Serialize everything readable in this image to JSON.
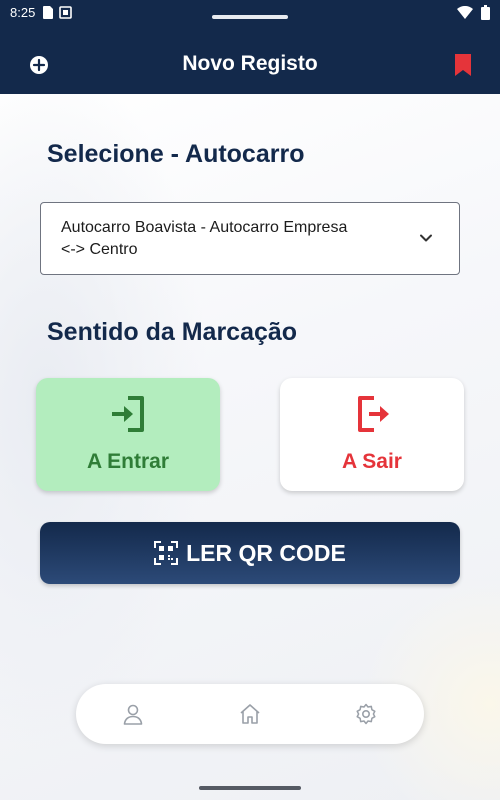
{
  "status_bar": {
    "time": "8:25",
    "left_icons": [
      "sim-card-icon",
      "square-icon"
    ],
    "right_icons": [
      "wifi-icon",
      "battery-icon"
    ]
  },
  "app_bar": {
    "title": "Novo Registo",
    "left_icon": "add-circle-icon",
    "right_icon": "bookmark-icon",
    "bookmark_color": "#e5343a"
  },
  "bus_section": {
    "heading": "Selecione - Autocarro",
    "selected_bus_line1": "Autocarro Boavista - Autocarro Empresa",
    "selected_bus_line2": "<-> Centro"
  },
  "direction_section": {
    "heading": "Sentido da Marcação",
    "enter_label": "A Entrar",
    "exit_label": "A Sair",
    "enter_color": "#2f7d37",
    "exit_color": "#e5343a",
    "selected": "A Entrar"
  },
  "qr_button": {
    "label": "LER QR CODE",
    "icon": "qr-code-scan-icon"
  },
  "bottom_nav": {
    "items": [
      {
        "icon": "profile-icon"
      },
      {
        "icon": "home-icon"
      },
      {
        "icon": "settings-icon"
      }
    ]
  },
  "colors": {
    "primary": "#13294b",
    "enter_bg": "#b3edbe"
  }
}
